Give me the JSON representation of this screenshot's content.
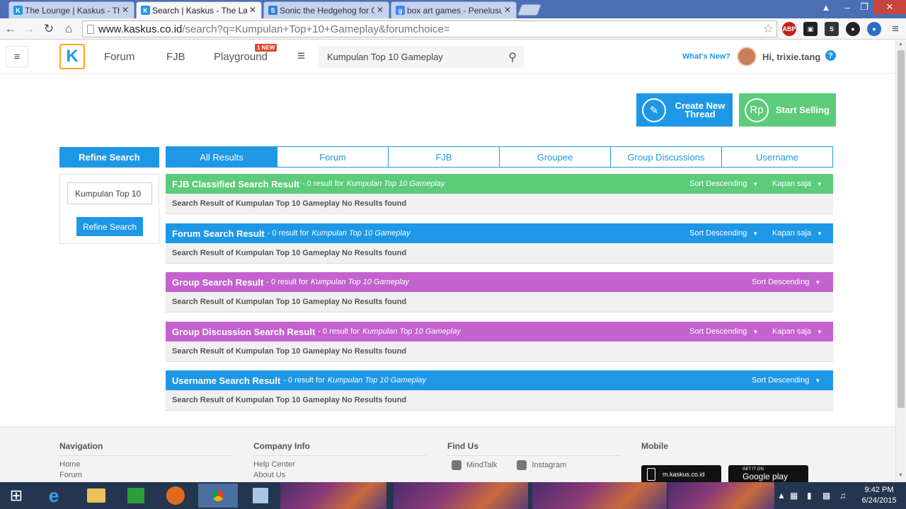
{
  "browser": {
    "tabs": [
      {
        "title": "The Lounge | Kaskus - The",
        "favicon": "K",
        "color": "#1e98e6"
      },
      {
        "title": "Search | Kaskus - The Larg",
        "favicon": "K",
        "color": "#1e98e6"
      },
      {
        "title": "Sonic the Hedgehog for G",
        "favicon": "S",
        "color": "#3b7dd8"
      },
      {
        "title": "box art games - Penelusur",
        "favicon": "g",
        "color": "#4285f4"
      }
    ],
    "close_glyph": "✕",
    "url_host": "www.kaskus.co.id",
    "url_path": "/search?q=Kumpulan+Top+10+Gameplay&forumchoice="
  },
  "header": {
    "nav": [
      "Forum",
      "FJB",
      "Playground"
    ],
    "new_badge": "1 NEW",
    "search_value": "Kumpulan Top 10 Gameplay",
    "whats_new": "What's New?",
    "greeting": "Hi, trixie.tang"
  },
  "actions": {
    "create_thread": "Create New Thread",
    "start_selling": "Start Selling",
    "create_color": "#1e98e6",
    "selling_color": "#5ccc7a"
  },
  "refine": {
    "title": "Refine Search",
    "input_value": "Kumpulan Top 10",
    "button": "Refine Search"
  },
  "result_tabs": [
    "All Results",
    "Forum",
    "FJB",
    "Groupee",
    "Group Discussions",
    "Username"
  ],
  "results": [
    {
      "title": "FJB Classified Search Result",
      "count": "- 0 result for",
      "term": "Kumpulan Top 10 Gameplay",
      "sort": "Sort Descending",
      "time": "Kapan saja",
      "color": "#5ccc7a",
      "body": "Search Result of Kumpulan Top 10 Gameplay No Results found"
    },
    {
      "title": "Forum Search Result",
      "count": "- 0 result for",
      "term": "Kumpulan Top 10 Gameplay",
      "sort": "Sort Descending",
      "time": "Kapan saja",
      "color": "#1e98e6",
      "body": "Search Result of Kumpulan Top 10 Gameplay No Results found"
    },
    {
      "title": "Group Search Result",
      "count": "- 0 result for",
      "term": "Kumpulan Top 10 Gameplay",
      "sort": "Sort Descending",
      "time": "",
      "color": "#c462d0",
      "body": "Search Result of Kumpulan Top 10 Gameplay No Results found"
    },
    {
      "title": "Group Discussion Search Result",
      "count": "- 0 result for",
      "term": "Kumpulan Top 10 Gameplay",
      "sort": "Sort Descending",
      "time": "Kapan saja",
      "color": "#c462d0",
      "body": "Search Result of Kumpulan Top 10 Gameplay No Results found"
    },
    {
      "title": "Username Search Result",
      "count": "- 0 result for",
      "term": "Kumpulan Top 10 Gameplay",
      "sort": "Sort Descending",
      "time": "",
      "color": "#1e98e6",
      "body": "Search Result of Kumpulan Top 10 Gameplay No Results found"
    }
  ],
  "footer": {
    "navigation": {
      "title": "Navigation",
      "links": [
        "Home",
        "Forum"
      ]
    },
    "company": {
      "title": "Company Info",
      "links": [
        "Help Center",
        "About Us"
      ]
    },
    "findus": {
      "title": "Find Us",
      "links": [
        "MindTalk",
        "Instagram"
      ]
    },
    "mobile": {
      "title": "Mobile",
      "apps": [
        "m.kaskus.co.id",
        "Google play"
      ],
      "google_small": "GET IT ON"
    }
  },
  "taskbar": {
    "time": "9:42 PM",
    "date": "6/24/2015"
  }
}
